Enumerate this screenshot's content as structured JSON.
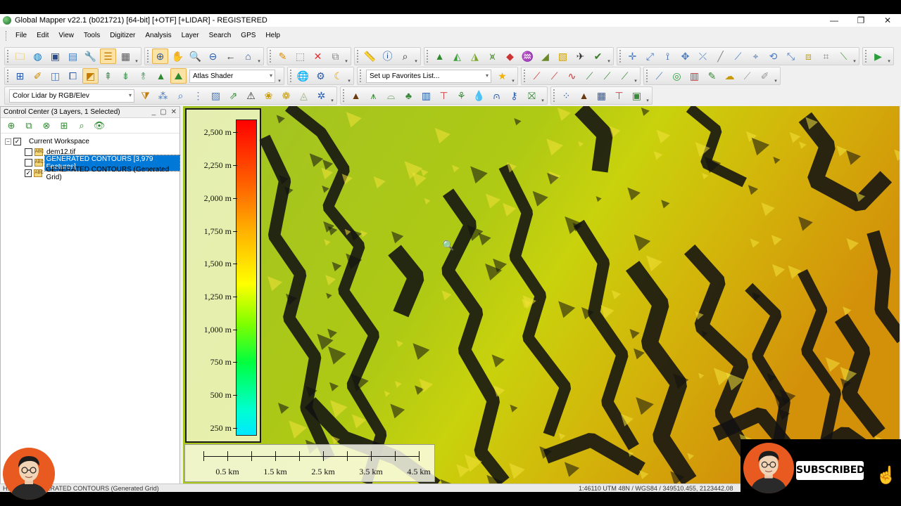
{
  "window": {
    "title": "Global Mapper v22.1 (b021721) [64-bit] [+OTF] [+LIDAR] - REGISTERED",
    "minimize": "—",
    "restore": "❐",
    "close": "✕"
  },
  "menu": [
    "File",
    "Edit",
    "View",
    "Tools",
    "Digitizer",
    "Analysis",
    "Layer",
    "Search",
    "GPS",
    "Help"
  ],
  "toolbar": {
    "shader": "Atlas Shader",
    "favorites": "Set up Favorites List...",
    "lidar_color": "Color Lidar by RGB/Elev"
  },
  "control_center": {
    "title": "Control Center (3 Layers, 1 Selected)",
    "workspace": "Current Workspace",
    "layers": [
      {
        "name": "dem12.tif",
        "checked": false,
        "selected": false
      },
      {
        "name": "GENERATED CONTOURS [3,979 Features]",
        "checked": false,
        "selected": true
      },
      {
        "name": "GENERATED CONTOURS (Generated Grid)",
        "checked": true,
        "selected": false
      }
    ]
  },
  "legend": {
    "ticks": [
      "2,500 m",
      "2,250 m",
      "2,000 m",
      "1,750 m",
      "1,500 m",
      "1,250 m",
      "1,000 m",
      "750 m",
      "500 m",
      "250 m"
    ],
    "colors": {
      "high": "#ff0000",
      "mid_high": "#ff9a00",
      "mid": "#ffff00",
      "mid_low": "#00ff40",
      "low": "#00e8ff"
    }
  },
  "scalebar": {
    "labels": [
      "0.5 km",
      "1.5 km",
      "2.5 km",
      "3.5 km",
      "4.5 km"
    ]
  },
  "status": {
    "left": "H... 68 m (GENERATED CONTOURS (Generated Grid)",
    "right": "1:46110  UTM 48N / WGS84 / 349510.455, 2123442.08"
  },
  "overlay": {
    "subscribed": "SUBSCRIBED"
  }
}
